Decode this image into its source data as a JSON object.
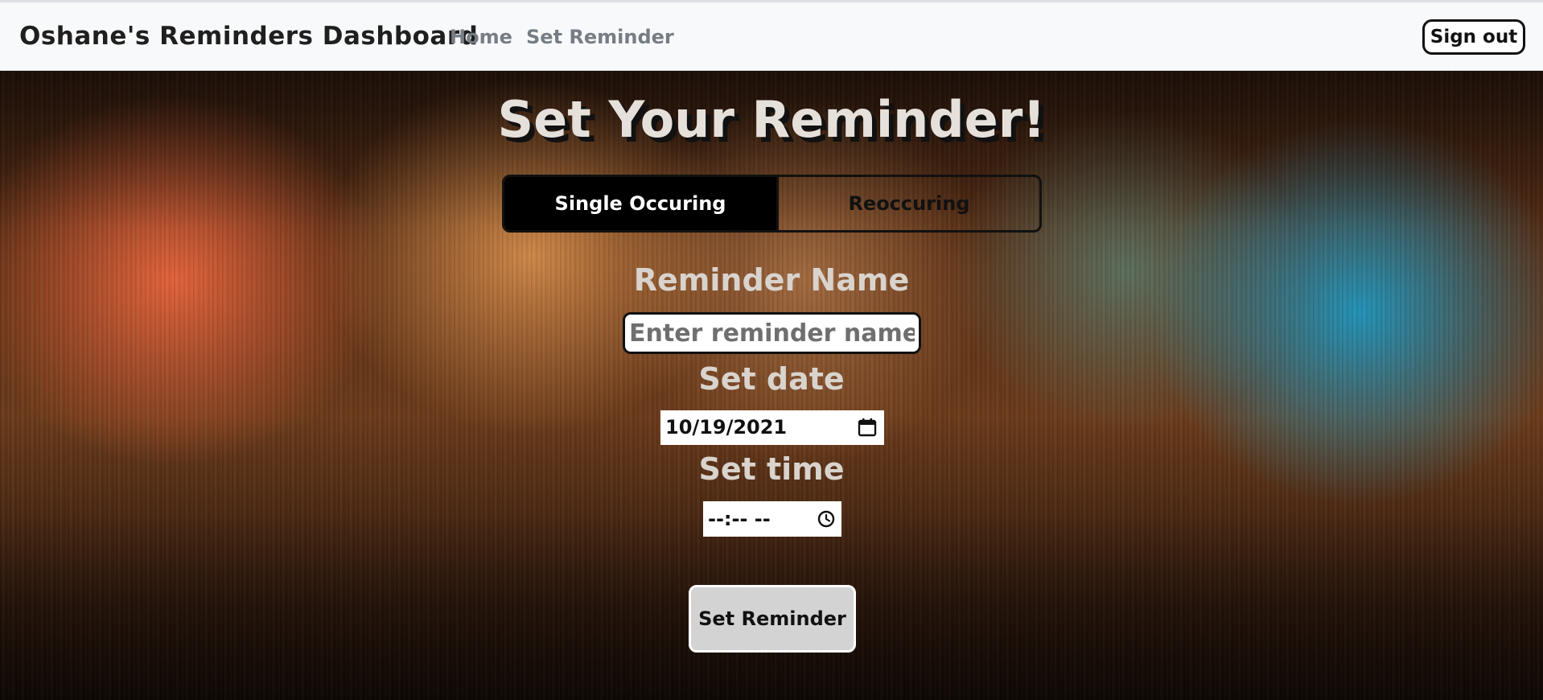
{
  "navbar": {
    "brand": "Oshane's Reminders Dashboard",
    "links": [
      {
        "label": "Home"
      },
      {
        "label": "Set Reminder"
      }
    ],
    "signout_label": "Sign out"
  },
  "page": {
    "title": "Set Your Reminder!",
    "toggle": {
      "options": [
        "Single Occuring",
        "Reoccuring"
      ],
      "selected": "Single Occuring"
    },
    "form": {
      "name_label": "Reminder Name",
      "name_placeholder": "Enter reminder name",
      "name_value": "",
      "date_label": "Set date",
      "date_value": "10/19/2021",
      "time_label": "Set time",
      "time_value": "--:-- --",
      "submit_label": "Set Reminder"
    }
  },
  "icons": {
    "date_picker": "calendar-icon",
    "time_picker": "clock-icon"
  },
  "colors": {
    "navbar_bg": "#f8f9fa",
    "toggle_active_bg": "#000000",
    "submit_bg": "#d3d3d3",
    "label_text": "#d9d3cd"
  }
}
